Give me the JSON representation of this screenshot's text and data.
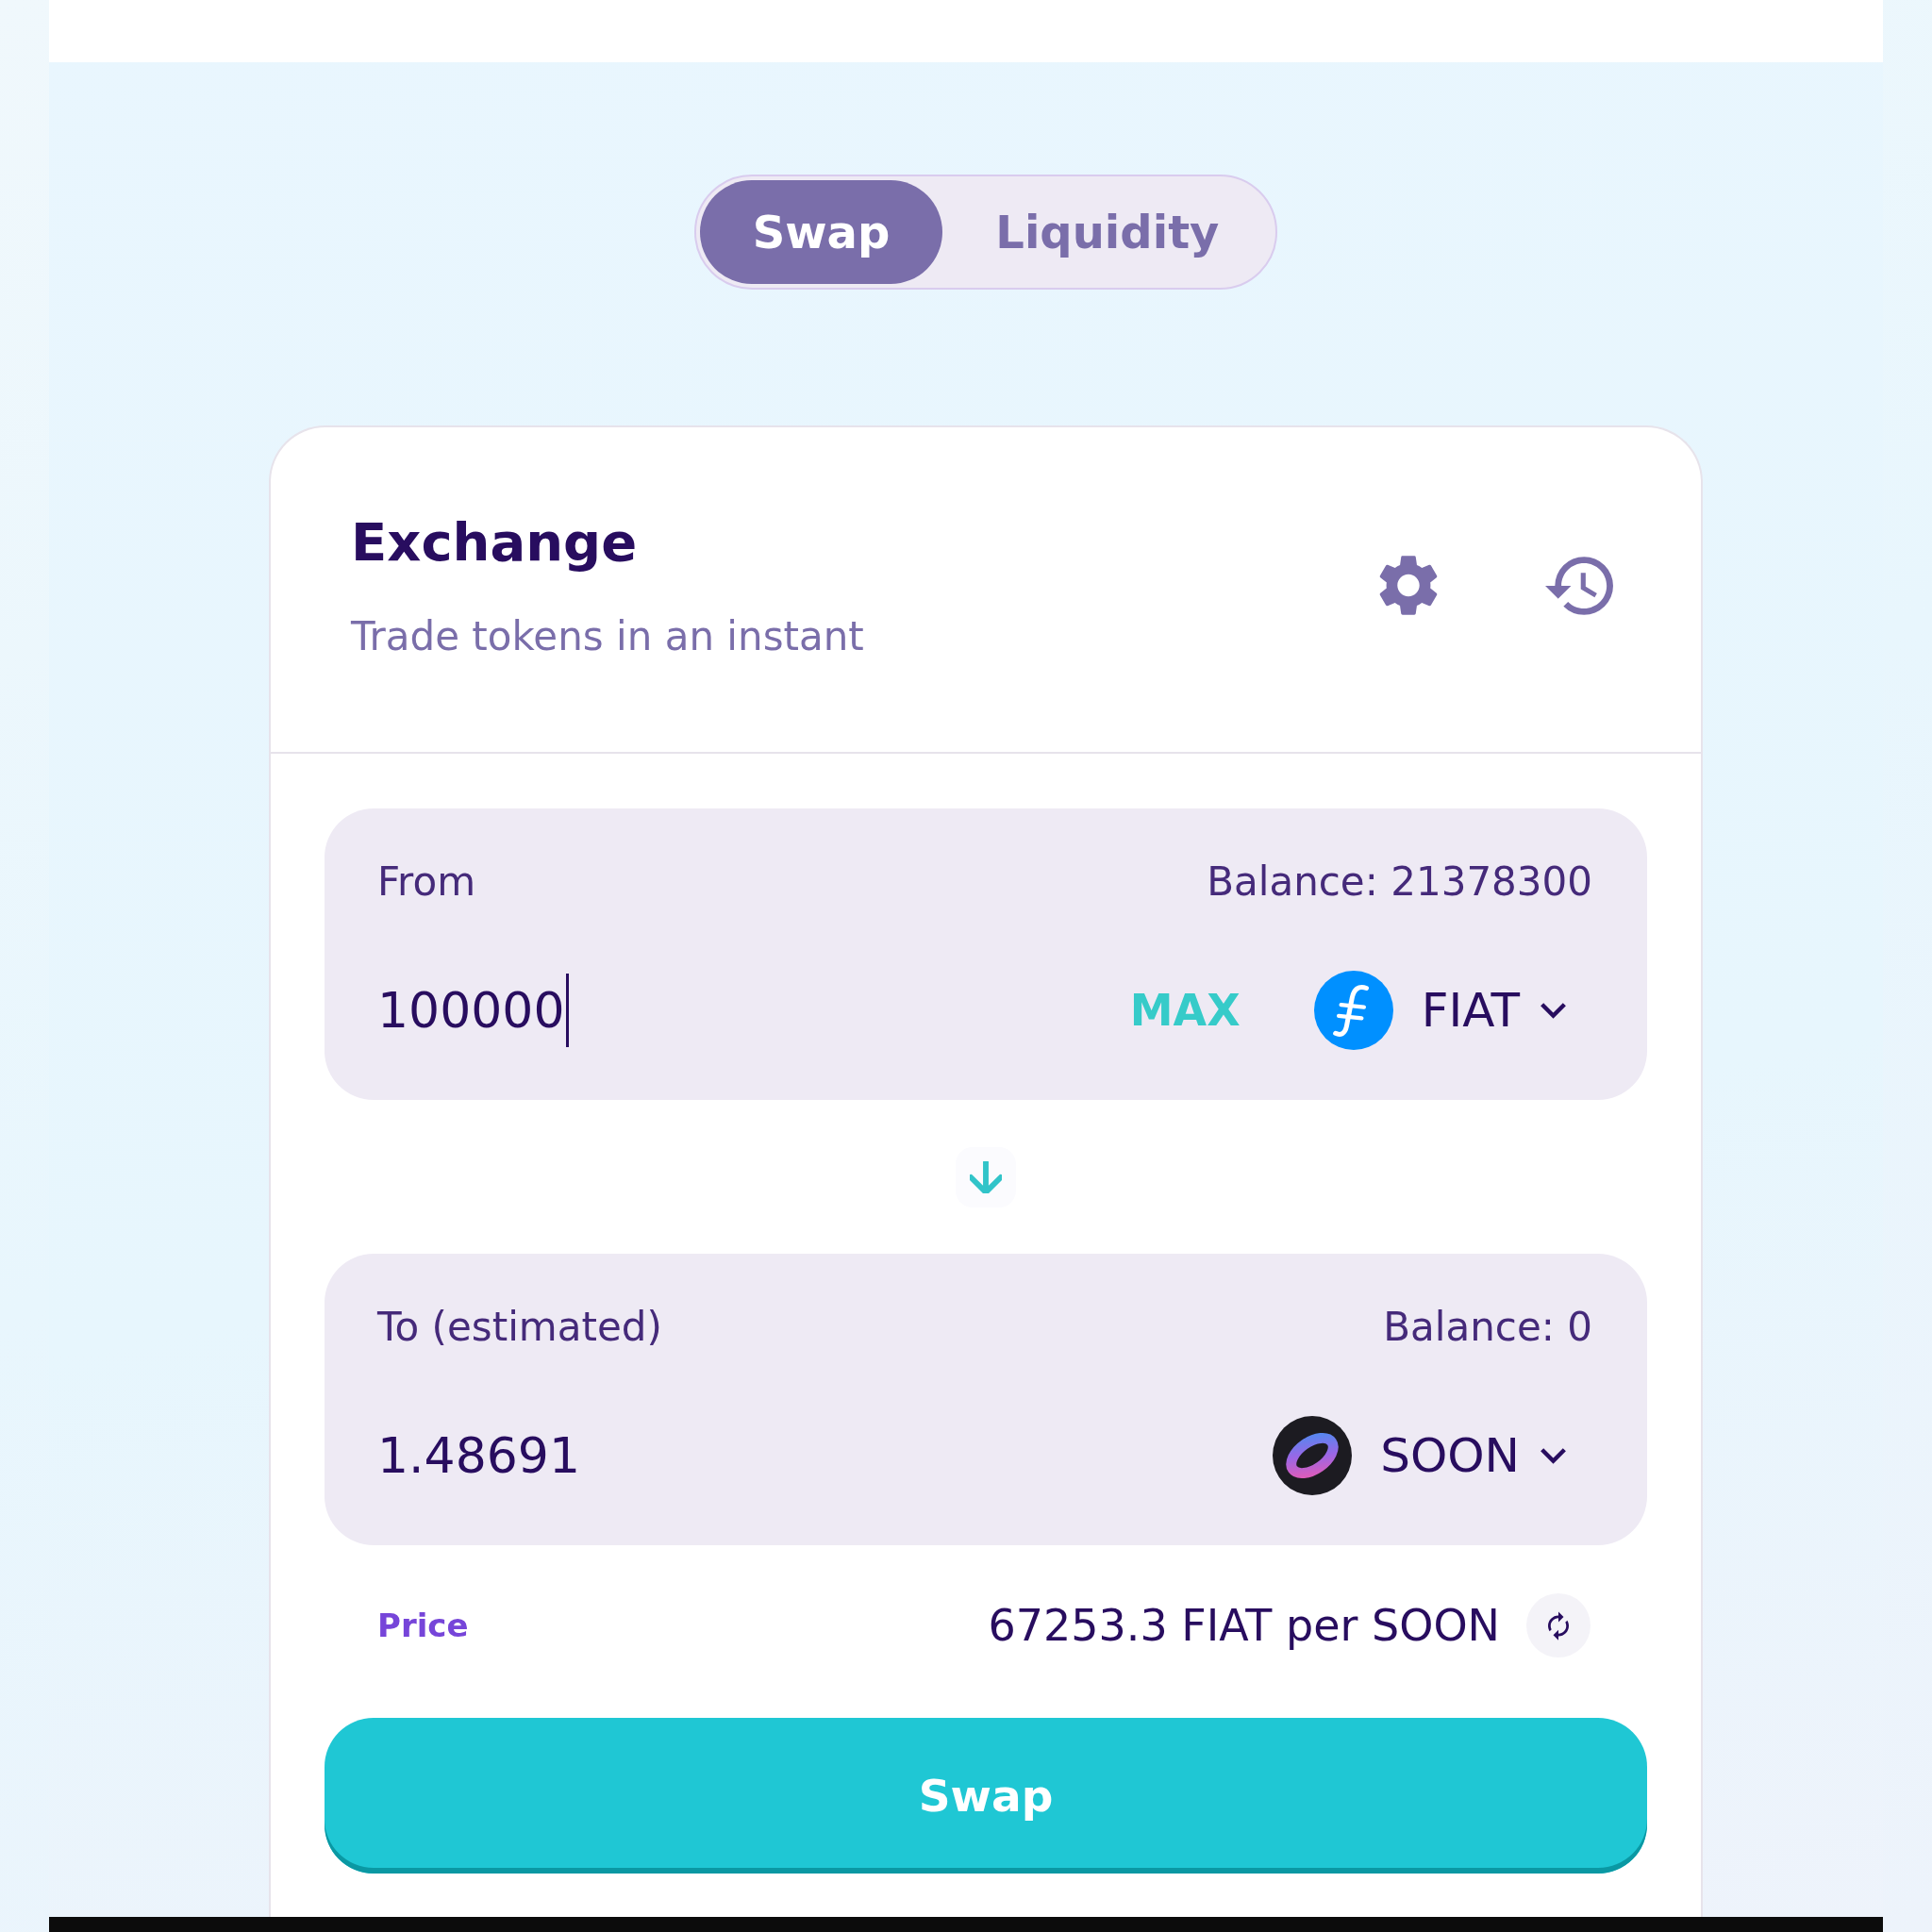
{
  "tabs": [
    {
      "label": "Swap",
      "selected": true
    },
    {
      "label": "Liquidity",
      "selected": false
    }
  ],
  "card": {
    "title": "Exchange",
    "subtitle": "Trade tokens in an instant"
  },
  "panels": [
    {
      "label": "From",
      "balance": "Balance: 21378300",
      "value": "100000",
      "focused": true,
      "max": "MAX",
      "token": "FIAT"
    },
    {
      "label": "To (estimated)",
      "balance": "Balance: 0",
      "value": "1.48691",
      "focused": false,
      "token": "SOON"
    }
  ],
  "price": {
    "label": "Price",
    "value": "67253.3 FIAT per SOON"
  },
  "swap_button": {
    "label": "Swap"
  }
}
